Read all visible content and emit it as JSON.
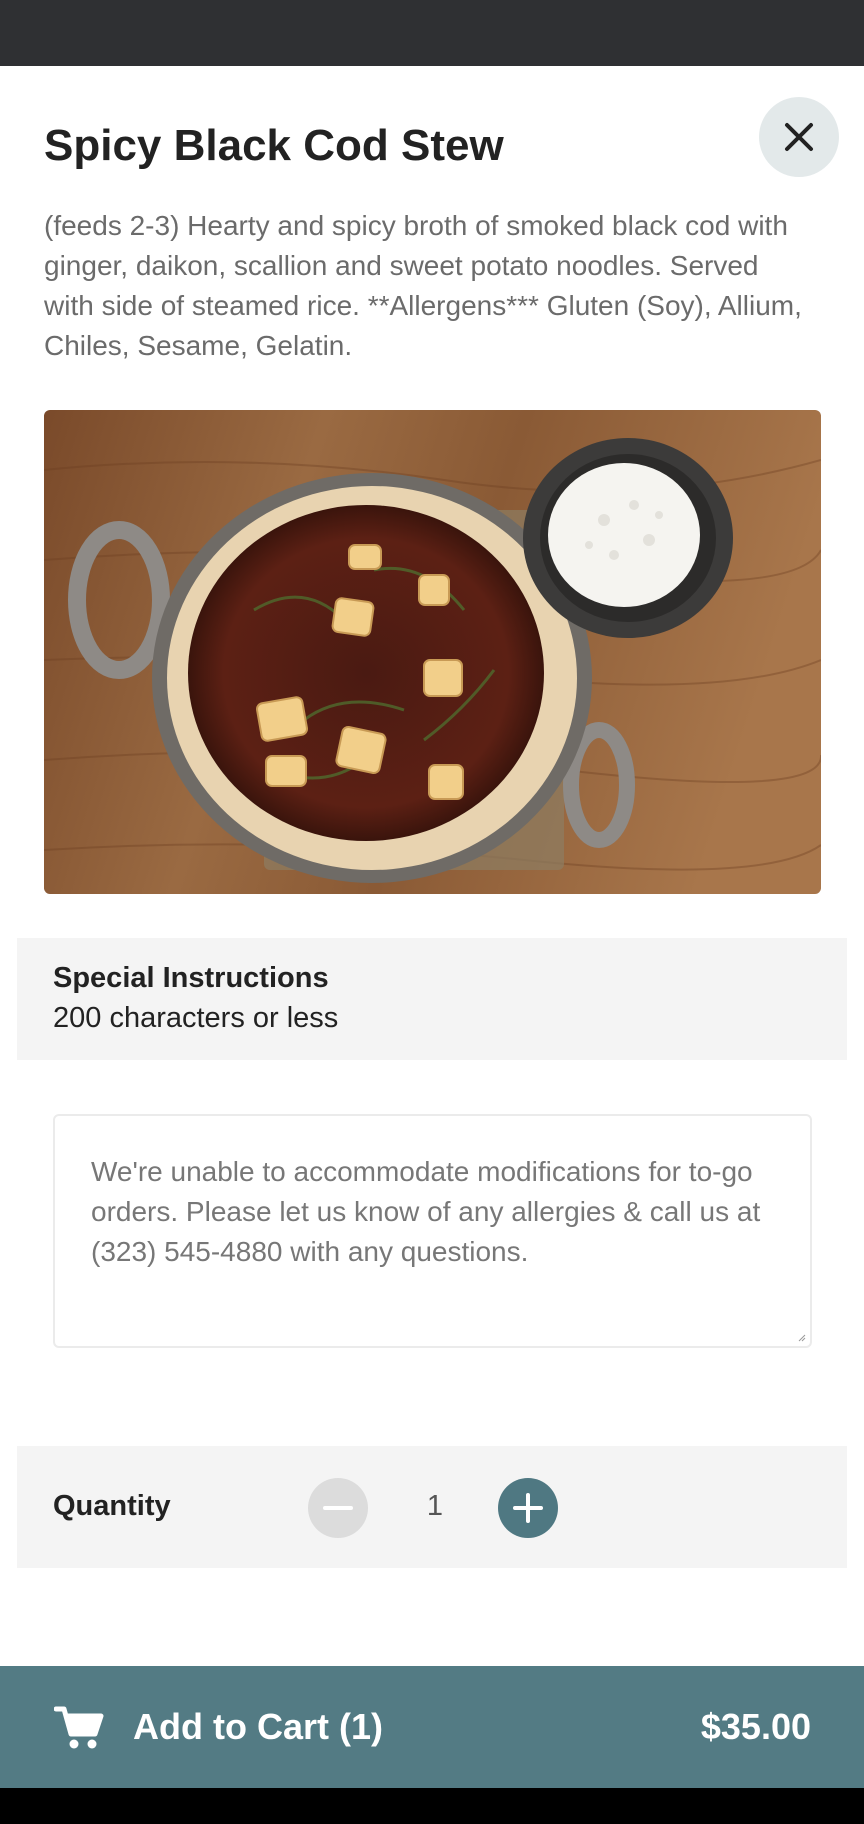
{
  "item": {
    "title": "Spicy Black Cod Stew",
    "description": "(feeds 2-3) Hearty and spicy broth of smoked black cod with ginger, daikon, scallion and sweet potato noodles. Served with side of steamed rice. **Allergens*** Gluten (Soy), Allium, Chiles, Sesame, Gelatin."
  },
  "instructions": {
    "title": "Special Instructions",
    "subtitle": "200 characters or less",
    "placeholder": "We're unable to accommodate modifications for to-go orders. Please let us know of any allergies & call us at (323) 545-4880 with any questions."
  },
  "quantity": {
    "label": "Quantity",
    "value": "1"
  },
  "cart": {
    "label": "Add to Cart (1)",
    "price": "$35.00"
  },
  "icons": {
    "close": "close-icon",
    "minus": "minus-icon",
    "plus": "plus-icon",
    "cart": "cart-icon"
  },
  "colors": {
    "accent": "#537b84",
    "close_bg": "#e3e9ea",
    "band_bg": "#f4f4f4"
  }
}
